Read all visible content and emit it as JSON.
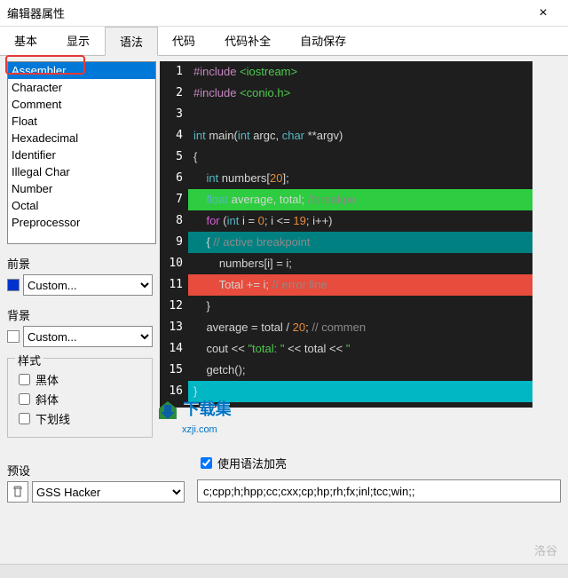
{
  "window": {
    "title": "编辑器属性",
    "close": "×"
  },
  "tabs": {
    "basic": "基本",
    "display": "显示",
    "syntax": "语法",
    "code": "代码",
    "completion": "代码补全",
    "autosave": "自动保存"
  },
  "syntaxList": [
    "Assembler",
    "Character",
    "Comment",
    "Float",
    "Hexadecimal",
    "Identifier",
    "Illegal Char",
    "Number",
    "Octal",
    "Preprocessor"
  ],
  "labels": {
    "foreground": "前景",
    "background": "背景",
    "style": "样式",
    "bold": "黑体",
    "italic": "斜体",
    "underline": "下划线",
    "preset": "预设",
    "useHighlighting": "使用语法加亮"
  },
  "combos": {
    "fg": {
      "value": "Custom...",
      "swatch": "#0033cc"
    },
    "bg": {
      "value": "Custom...",
      "swatch": "#ffffff"
    },
    "preset": {
      "value": "GSS Hacker"
    }
  },
  "ext": {
    "value": "c;cpp;h;hpp;cc;cxx;cp;hp;rh;fx;inl;tcc;win;;"
  },
  "checks": {
    "bold": false,
    "italic": false,
    "underline": false,
    "highlighting": true
  },
  "code": {
    "lines": [
      {
        "n": "1",
        "segs": [
          [
            "c-include",
            "#include"
          ],
          [
            "c-white",
            " "
          ],
          [
            "c-green",
            "<iostream>"
          ]
        ]
      },
      {
        "n": "2",
        "segs": [
          [
            "c-include",
            "#include"
          ],
          [
            "c-white",
            " "
          ],
          [
            "c-green",
            "<conio.h>"
          ]
        ]
      },
      {
        "n": "3",
        "segs": []
      },
      {
        "n": "4",
        "segs": [
          [
            "c-cyan",
            "int "
          ],
          [
            "c-white",
            "main("
          ],
          [
            "c-cyan",
            "int "
          ],
          [
            "c-white",
            "argc, "
          ],
          [
            "c-cyan",
            "char "
          ],
          [
            "c-white",
            "**argv)"
          ]
        ]
      },
      {
        "n": "5",
        "segs": [
          [
            "c-white",
            "{"
          ]
        ]
      },
      {
        "n": "6",
        "segs": [
          [
            "c-white",
            "    "
          ],
          [
            "c-cyan",
            "int "
          ],
          [
            "c-white",
            "numbers["
          ],
          [
            "c-orange",
            "20"
          ],
          [
            "c-white",
            "];"
          ]
        ]
      },
      {
        "n": "7",
        "bg": "bg-green",
        "segs": [
          [
            "c-white",
            "    "
          ],
          [
            "c-cyan",
            "float"
          ],
          [
            "c-white",
            " average, total; "
          ],
          [
            "c-comment",
            "//breakpo"
          ]
        ]
      },
      {
        "n": "8",
        "segs": [
          [
            "c-white",
            "    "
          ],
          [
            "c-key",
            "for "
          ],
          [
            "c-white",
            "("
          ],
          [
            "c-cyan",
            "int "
          ],
          [
            "c-white",
            "i = "
          ],
          [
            "c-orange",
            "0"
          ],
          [
            "c-white",
            "; i <= "
          ],
          [
            "c-orange",
            "19"
          ],
          [
            "c-white",
            "; i++)"
          ]
        ]
      },
      {
        "n": "9",
        "bg": "bg-teal",
        "segs": [
          [
            "c-white",
            "    { "
          ],
          [
            "c-comment",
            "// active breakpoint"
          ]
        ]
      },
      {
        "n": "10",
        "segs": [
          [
            "c-white",
            "        numbers[i] = i;"
          ]
        ]
      },
      {
        "n": "11",
        "bg": "bg-red",
        "segs": [
          [
            "c-white",
            "        Total += i; "
          ],
          [
            "c-comment",
            "// error line"
          ]
        ]
      },
      {
        "n": "12",
        "segs": [
          [
            "c-white",
            "    }"
          ]
        ]
      },
      {
        "n": "13",
        "segs": [
          [
            "c-white",
            "    average = total / "
          ],
          [
            "c-orange",
            "20"
          ],
          [
            "c-white",
            "; "
          ],
          [
            "c-comment",
            "// commen"
          ]
        ]
      },
      {
        "n": "14",
        "segs": [
          [
            "c-white",
            "    cout << "
          ],
          [
            "c-green",
            "\"total: \""
          ],
          [
            "c-white",
            " << total << "
          ],
          [
            "c-green",
            "\""
          ]
        ]
      },
      {
        "n": "15",
        "segs": [
          [
            "c-white",
            "    getch();"
          ]
        ]
      },
      {
        "n": "16",
        "bg": "bg-cyanline",
        "segs": [
          [
            "c-white",
            "}"
          ]
        ]
      }
    ]
  },
  "watermark": {
    "main": "下载集",
    "sub": "xzji.com",
    "right": "洛谷"
  }
}
